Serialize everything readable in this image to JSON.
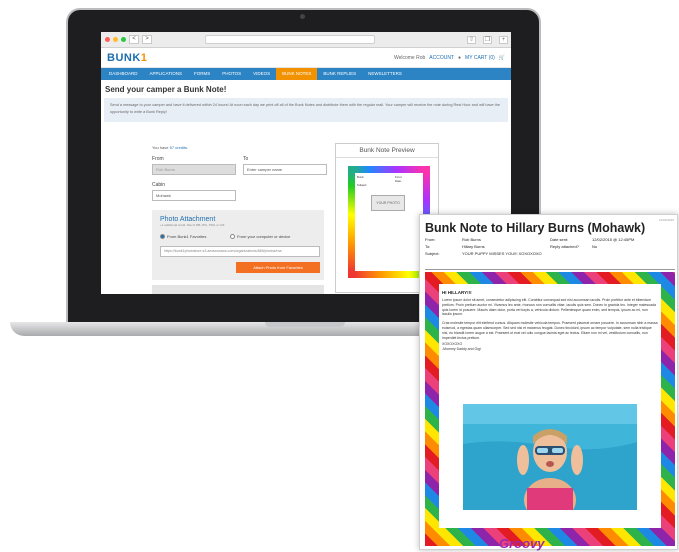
{
  "browser": {
    "nav_back": "<",
    "nav_forward": ">",
    "share_icon": "share-icon",
    "tabs_icon": "tabs-icon"
  },
  "site": {
    "logo_text": "BUNK",
    "logo_num": "1",
    "welcome": "Welcome Rob",
    "account": "ACCOUNT",
    "cart": "MY CART (0)",
    "nav": [
      "DASHBOARD",
      "APPLICATIONS",
      "FORMS",
      "PHOTOS",
      "VIDEOS",
      "BUNK NOTES",
      "BUNK REPLIES",
      "NEWSLETTERS"
    ],
    "active_nav": "BUNK NOTES"
  },
  "page": {
    "title": "Send your camper a Bunk Note!",
    "info": "Send a message to your camper and have it delivered within 24 hours! At noon each day we print off all of the Bunk Notes and distribute them with the regular mail. Your camper will receive the note during Rest Hour and will have the opportunity to write a Bunk Reply!",
    "credits_prefix": "You have",
    "credits_value": "57 credits",
    "credits_suffix": ".",
    "from_label": "From",
    "from_value": "Rob Burns",
    "to_label": "To",
    "to_placeholder": "Enter camper name",
    "cabin_label": "Cabin",
    "cabin_value": "Mohawk",
    "photo_title": "Photo Attachment",
    "photo_sub": "+1 additional credit. Max 6 MB JPG, PNG or GIF",
    "opt_favorites": "From Bunk1 Favorites",
    "opt_computer": "From your computer or device",
    "photo_url": "https://bunk1photostore.s3.amazonaws.com/organizations/869/photos/ma",
    "attach_button": "Attach Photo from Favorites",
    "preview_title": "Bunk Note Preview",
    "preview_bunk": "Bunk:",
    "preview_subject": "Subject:",
    "preview_from": "From:",
    "preview_date": "Date:",
    "preview_photo": "YOUR PHOTO"
  },
  "note": {
    "date_corner": "12/02/2015",
    "title": "Bunk Note to Hillary Burns (Mohawk)",
    "from_label": "From:",
    "from_value": "Rob Burns",
    "to_label": "To:",
    "to_value": "Hillary Burns",
    "subject_label": "Subject:",
    "subject_value": "YOUR PUPPY MISSES YOU!!! XOXOXOXO",
    "date_label": "Date sent:",
    "date_value": "12/02/2015 @ 12:45PM",
    "reply_label": "Reply attached?",
    "reply_value": "No",
    "greeting": "HI HILLARY!!!",
    "paragraph1": "Lorem ipsum dolor sit amet, consectetur adipiscing elit. Curabitur consequat sed nisi accumsan iaculis. Proin porttitor ante et bibendum pretium. Proin pretium auctor mi. Vivamus leo ante, rhoncus non convallis vitae, iaculis quis sem. Donec in gravida leo. Integer malesuada quis lorem id posuere. Mauris diam dolor, porta vel turpis a, vehicula dictum. Pellentesque quam enim, sed tempus, ipsum ac mi, non iaculis ipsum.",
    "paragraph2": "Cras molestie tempor elit eleifend cursus. Aliquam molestie vehicula tempus. Praesent placerat ornare posuere. In accumsan nibh a massa euismod, a egestas quam ullamcorper. Sed sed nisi et maximus feugiat. Donec tincidunt, ipsum ac tempor vulputate, sem nulla tristique nisl, eu blandit lorem augue a est. Praesent ut erat vel odio congue lacinia eget ac lectus. Etiam non mi vel, vestibulum convallis, non imperdiet lectus pretium.",
    "signoff_1": "XOXOXOXO",
    "signoff_2": "-Mommy Daddy and Gigi",
    "frame_word": "Groovy"
  },
  "colors": {
    "brand_blue": "#2c84c5",
    "brand_orange": "#f39200"
  }
}
